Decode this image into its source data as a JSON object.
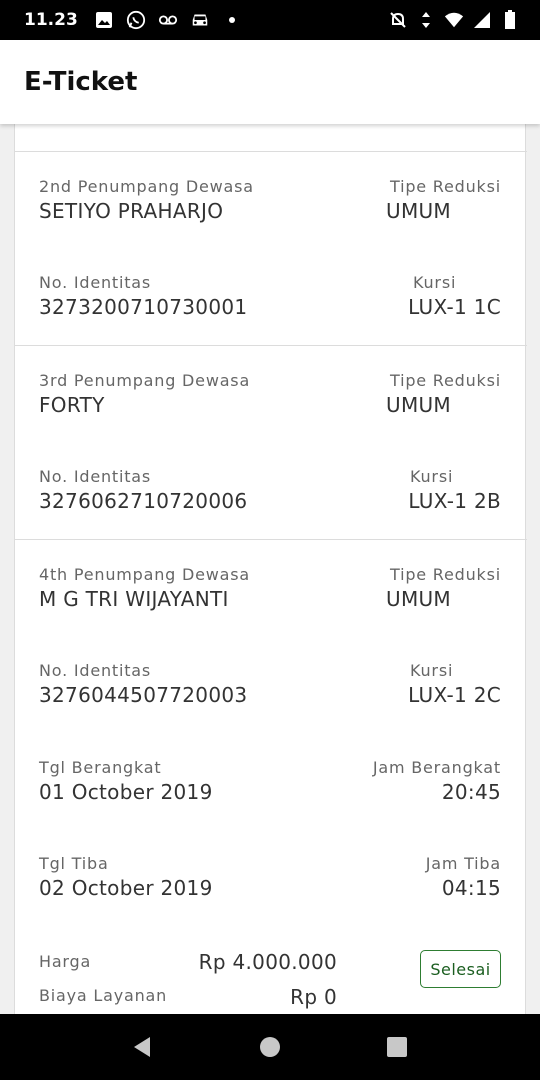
{
  "status_bar": {
    "time": "11.23",
    "icons_left": [
      "image-icon",
      "whatsapp-icon",
      "voicemail-icon",
      "car-icon",
      "dot-icon"
    ],
    "icons_right": [
      "mute-icon",
      "data-arrows-icon",
      "wifi-icon",
      "signal-icon",
      "battery-icon"
    ]
  },
  "app_bar": {
    "title": "E-Ticket"
  },
  "passengers": [
    {
      "title": "2nd Penumpang Dewasa",
      "name": "SETIYO PRAHARJO",
      "reduction_label": "Tipe Reduksi",
      "reduction": "UMUM",
      "id_label": "No. Identitas",
      "id_number": "3273200710730001",
      "seat_label": "Kursi",
      "seat": "LUX-1 1C"
    },
    {
      "title": "3rd Penumpang Dewasa",
      "name": "FORTY",
      "reduction_label": "Tipe Reduksi",
      "reduction": "UMUM",
      "id_label": "No. Identitas",
      "id_number": "3276062710720006",
      "seat_label": "Kursi",
      "seat": "LUX-1 2B"
    },
    {
      "title": "4th Penumpang Dewasa",
      "name": "M G TRI WIJAYANTI",
      "reduction_label": "Tipe Reduksi",
      "reduction": "UMUM",
      "id_label": "No. Identitas",
      "id_number": "3276044507720003",
      "seat_label": "Kursi",
      "seat": "LUX-1 2C"
    }
  ],
  "schedule": {
    "depart_date_label": "Tgl Berangkat",
    "depart_date": "01 October 2019",
    "depart_time_label": "Jam Berangkat",
    "depart_time": "20:45",
    "arrive_date_label": "Tgl Tiba",
    "arrive_date": "02 October 2019",
    "arrive_time_label": "Jam Tiba",
    "arrive_time": "04:15"
  },
  "payment": {
    "price_label": "Harga",
    "price": "Rp 4.000.000",
    "fee_label": "Biaya Layanan",
    "fee": "Rp 0",
    "status": "Selesai",
    "status_color": "#2e7d32"
  },
  "nav_bar": {
    "buttons": [
      "back-icon",
      "home-icon",
      "recents-icon"
    ]
  }
}
